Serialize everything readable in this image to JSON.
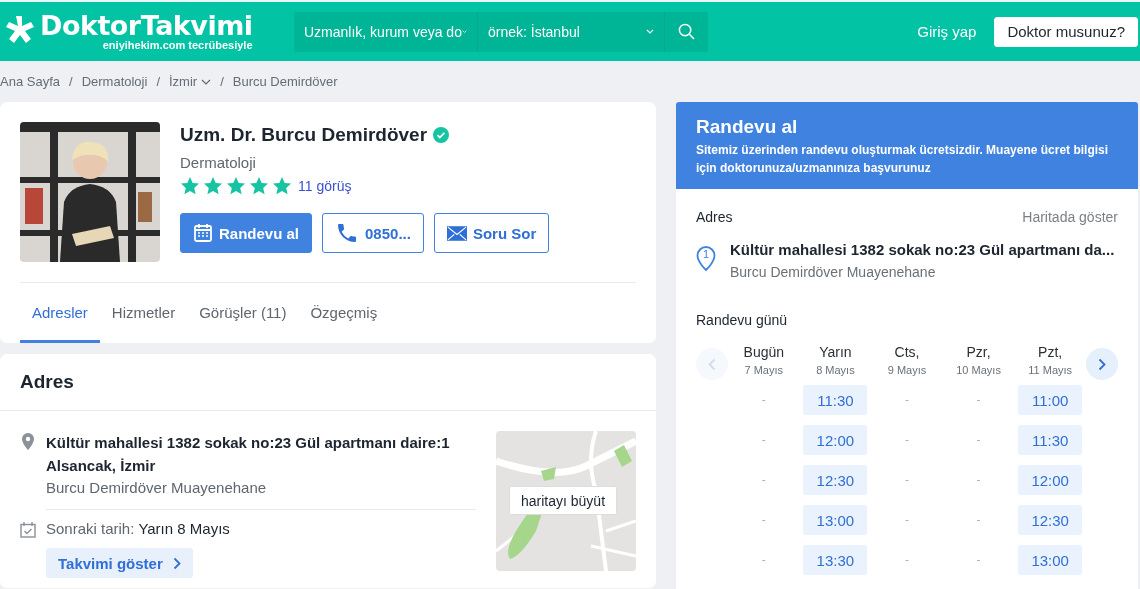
{
  "header": {
    "logo": "DoktorTakvimi",
    "tagline": "eniyihekim.com tecrübesiyle",
    "search": {
      "specialty": "Uzmanlık, kurum veya do",
      "city_placeholder": "örnek: İstanbul"
    },
    "login": "Giriş yap",
    "doctor_button": "Doktor musunuz?"
  },
  "breadcrumb_separator": "/",
  "breadcrumb": [
    {
      "label": "Ana Sayfa",
      "dropdown": false
    },
    {
      "label": "Dermatoloji",
      "dropdown": false
    },
    {
      "label": "İzmir",
      "dropdown": true
    },
    {
      "label": "Burcu Demirdöver",
      "dropdown": false
    }
  ],
  "profile": {
    "name": "Uzm. Dr. Burcu Demirdöver",
    "verified": true,
    "specialty": "Dermatoloji",
    "stars": 5,
    "reviews": "11 görüş",
    "buttons": [
      {
        "kind": "calendar",
        "label": "Randevu al"
      },
      {
        "kind": "phone",
        "label": "0850..."
      },
      {
        "kind": "mail",
        "label": "Soru Sor"
      }
    ],
    "tabs": [
      {
        "label": "Adresler",
        "selected": true
      },
      {
        "label": "Hizmetler",
        "selected": false
      },
      {
        "label": "Görüşler (11)",
        "selected": false
      },
      {
        "label": "Özgeçmiş",
        "selected": false
      }
    ]
  },
  "address_card": {
    "title": "Adres",
    "address_lines": [
      "Kültür mahallesi 1382 sokak no:23 Gül apartmanı daire:1",
      "Alsancak, İzmir"
    ],
    "clinic": "Burcu Demirdöver Muayenehane",
    "next_label": "Sonraki tarih:",
    "next_value": "Yarın 8 Mayıs",
    "calendar_button": "Takvimi göster",
    "map_button": "haritayı büyüt"
  },
  "booking": {
    "title": "Randevu al",
    "note": "Sitemiz üzerinden randevu oluşturmak ücretsizdir. Muayene ücret bilgisi için doktorunuza/uzmanınıza başvurunuz",
    "address_label": "Adres",
    "map_link": "Haritada göster",
    "pin": "1",
    "address": "Kültür mahallesi 1382 sokak no:23 Gül apartmanı da...",
    "clinic": "Burcu Demirdöver Muayenehane",
    "day_label": "Randevu günü",
    "prev_disabled": true,
    "days": [
      {
        "day": "Bugün",
        "date": "7 Mayıs",
        "slots": [
          {
            "time": "-",
            "available": false
          },
          {
            "time": "-",
            "available": false
          },
          {
            "time": "-",
            "available": false
          },
          {
            "time": "-",
            "available": false
          },
          {
            "time": "-",
            "available": false
          }
        ]
      },
      {
        "day": "Yarın",
        "date": "8 Mayıs",
        "slots": [
          {
            "time": "11:30",
            "available": true
          },
          {
            "time": "12:00",
            "available": true
          },
          {
            "time": "12:30",
            "available": true
          },
          {
            "time": "13:00",
            "available": true
          },
          {
            "time": "13:30",
            "available": true
          }
        ]
      },
      {
        "day": "Cts,",
        "date": "9 Mayıs",
        "slots": [
          {
            "time": "-",
            "available": false
          },
          {
            "time": "-",
            "available": false
          },
          {
            "time": "-",
            "available": false
          },
          {
            "time": "-",
            "available": false
          },
          {
            "time": "-",
            "available": false
          }
        ]
      },
      {
        "day": "Pzr,",
        "date": "10 Mayıs",
        "slots": [
          {
            "time": "-",
            "available": false
          },
          {
            "time": "-",
            "available": false
          },
          {
            "time": "-",
            "available": false
          },
          {
            "time": "-",
            "available": false
          },
          {
            "time": "-",
            "available": false
          }
        ]
      },
      {
        "day": "Pzt,",
        "date": "11 Mayıs",
        "slots": [
          {
            "time": "11:00",
            "available": true
          },
          {
            "time": "11:30",
            "available": true
          },
          {
            "time": "12:00",
            "available": true
          },
          {
            "time": "12:30",
            "available": true
          },
          {
            "time": "13:00",
            "available": true
          }
        ]
      }
    ]
  }
}
